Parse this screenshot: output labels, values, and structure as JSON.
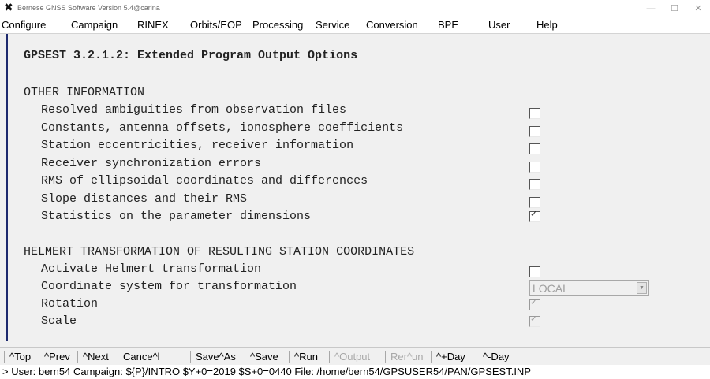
{
  "window": {
    "title": "Bernese GNSS Software Version 5.4@carina",
    "icon": "x-logo-icon"
  },
  "menu": [
    {
      "label": "Configure",
      "accel": "C"
    },
    {
      "label": "Campaign",
      "accel": "C"
    },
    {
      "label": "RINEX",
      "accel": "R"
    },
    {
      "label": "Orbits/EOP",
      "accel": "O"
    },
    {
      "label": "Processing",
      "accel": "P"
    },
    {
      "label": "Service",
      "accel": "S"
    },
    {
      "label": "Conversion",
      "accel": "v"
    },
    {
      "label": "BPE",
      "accel": "B"
    },
    {
      "label": "User",
      "accel": "U"
    },
    {
      "label": "Help",
      "accel": "H"
    }
  ],
  "panel": {
    "heading": "GPSEST 3.2.1.2: Extended Program Output Options",
    "section_other": "OTHER INFORMATION",
    "other_options": [
      {
        "label": "Resolved ambiguities from observation files",
        "checked": false
      },
      {
        "label": "Constants, antenna offsets, ionosphere coefficients",
        "checked": false
      },
      {
        "label": "Station eccentricities, receiver information",
        "checked": false
      },
      {
        "label": "Receiver synchronization errors",
        "checked": false
      },
      {
        "label": "RMS of ellipsoidal coordinates and differences",
        "checked": false
      },
      {
        "label": "Slope distances and their RMS",
        "checked": false
      },
      {
        "label": "Statistics on the parameter dimensions",
        "checked": true
      }
    ],
    "section_helmert": "HELMERT TRANSFORMATION OF RESULTING STATION COORDINATES",
    "helmert": {
      "activate_label": "Activate Helmert transformation",
      "activate_checked": false,
      "coord_system_label": "Coordinate system for transformation",
      "coord_system_value": "LOCAL",
      "rotation_label": "Rotation",
      "rotation_checked": true,
      "scale_label": "Scale",
      "scale_checked": true
    }
  },
  "toolbar": {
    "top": "^Top",
    "prev": "^Prev",
    "next": "^Next",
    "cancel": "Cance^l",
    "save_as": "Save^As",
    "save": "^Save",
    "run": "^Run",
    "output": "^Output",
    "rerun": "Rer^un",
    "plus_day": "^+Day",
    "minus_day": "^-Day"
  },
  "status": "> User: bern54  Campaign: ${P}/INTRO  $Y+0=2019  $S+0=0440  File: /home/bern54/GPSUSER54/PAN/GPSEST.INP"
}
